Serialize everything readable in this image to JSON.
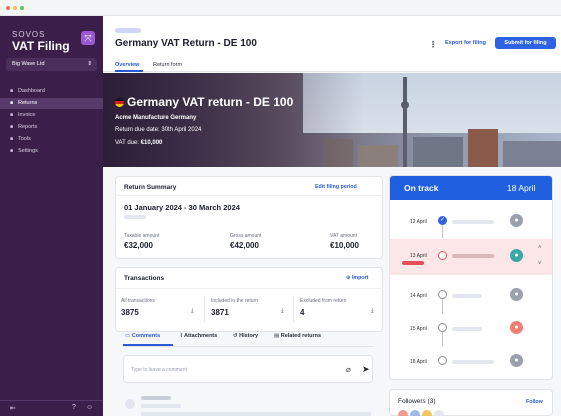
{
  "brand": {
    "top": "SOVOS",
    "name": "VAT Filing"
  },
  "company_selector": {
    "value": "Big Wave Ltd"
  },
  "nav": [
    {
      "label": "Dashboard"
    },
    {
      "label": "Returns"
    },
    {
      "label": "Invoice"
    },
    {
      "label": "Reports"
    },
    {
      "label": "Tools"
    },
    {
      "label": "Settings"
    }
  ],
  "header": {
    "title": "Germany VAT Return - DE 100",
    "export_label": "Export for filing",
    "submit_label": "Submit for filing",
    "tabs": [
      "Overview",
      "Return form"
    ]
  },
  "hero": {
    "title": "Germany VAT return - DE 100",
    "company": "Acme Manufacture Germany",
    "due_date_text": "Return due date: 30th April 2024",
    "vat_due_label": "VAT due:",
    "vat_due_value": "€10,000"
  },
  "summary": {
    "title": "Return Summary",
    "edit_link": "Edit filing period",
    "period": "01 January 2024 - 30 March 2024",
    "taxable_label": "Taxable amount",
    "taxable_value": "€32,000",
    "gross_label": "Gross amount",
    "gross_value": "€42,000",
    "vat_label": "VAT amount",
    "vat_value": "€10,000"
  },
  "transactions": {
    "title": "Transactions",
    "import_label": "Import",
    "all_label": "All transactions",
    "all_value": "3875",
    "included_label": "Included in the return",
    "included_value": "3871",
    "excluded_label": "Excluded from return",
    "excluded_value": "4"
  },
  "comment_tabs": [
    "Comments",
    "Attachments",
    "History",
    "Related returns"
  ],
  "comment_input": {
    "placeholder": "Type to leave a comment"
  },
  "status": {
    "label": "On track",
    "date": "18 April",
    "timeline": [
      {
        "date": "12 April",
        "state": "done"
      },
      {
        "date": "13 April",
        "state": "warning"
      },
      {
        "date": "14 April",
        "state": "pending"
      },
      {
        "date": "15 April",
        "state": "pending"
      },
      {
        "date": "18 April",
        "state": "pending"
      }
    ]
  },
  "followers": {
    "label": "Followers (3)",
    "follow_label": "Follow"
  },
  "colors": {
    "accent": "#2f63e6",
    "sidebar": "#3b1f4a",
    "warning": "#e24f5b"
  }
}
